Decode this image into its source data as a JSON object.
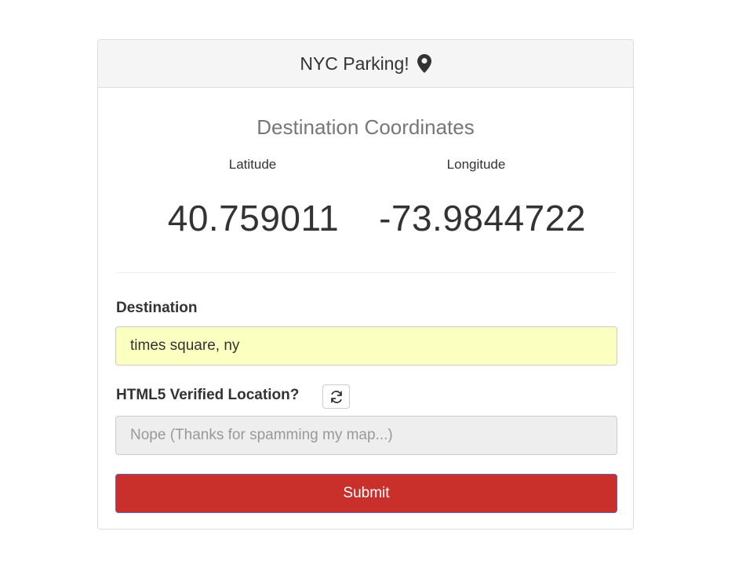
{
  "header": {
    "title": "NYC Parking!",
    "icon": "map-marker-icon"
  },
  "coordinates": {
    "title": "Destination Coordinates",
    "latitude_label": "Latitude",
    "latitude_value": "40.759011",
    "longitude_label": "Longitude",
    "longitude_value": "-73.9844722"
  },
  "form": {
    "destination_label": "Destination",
    "destination_value": "times square, ny",
    "verified_label": "HTML5 Verified Location?",
    "refresh_icon": "refresh-icon",
    "verified_placeholder": "Nope (Thanks for spamming my map...)",
    "submit_label": "Submit"
  },
  "colors": {
    "submit_bg": "#c9302c",
    "destination_bg": "#fbffbf",
    "heading_bg": "#f5f5f5"
  }
}
